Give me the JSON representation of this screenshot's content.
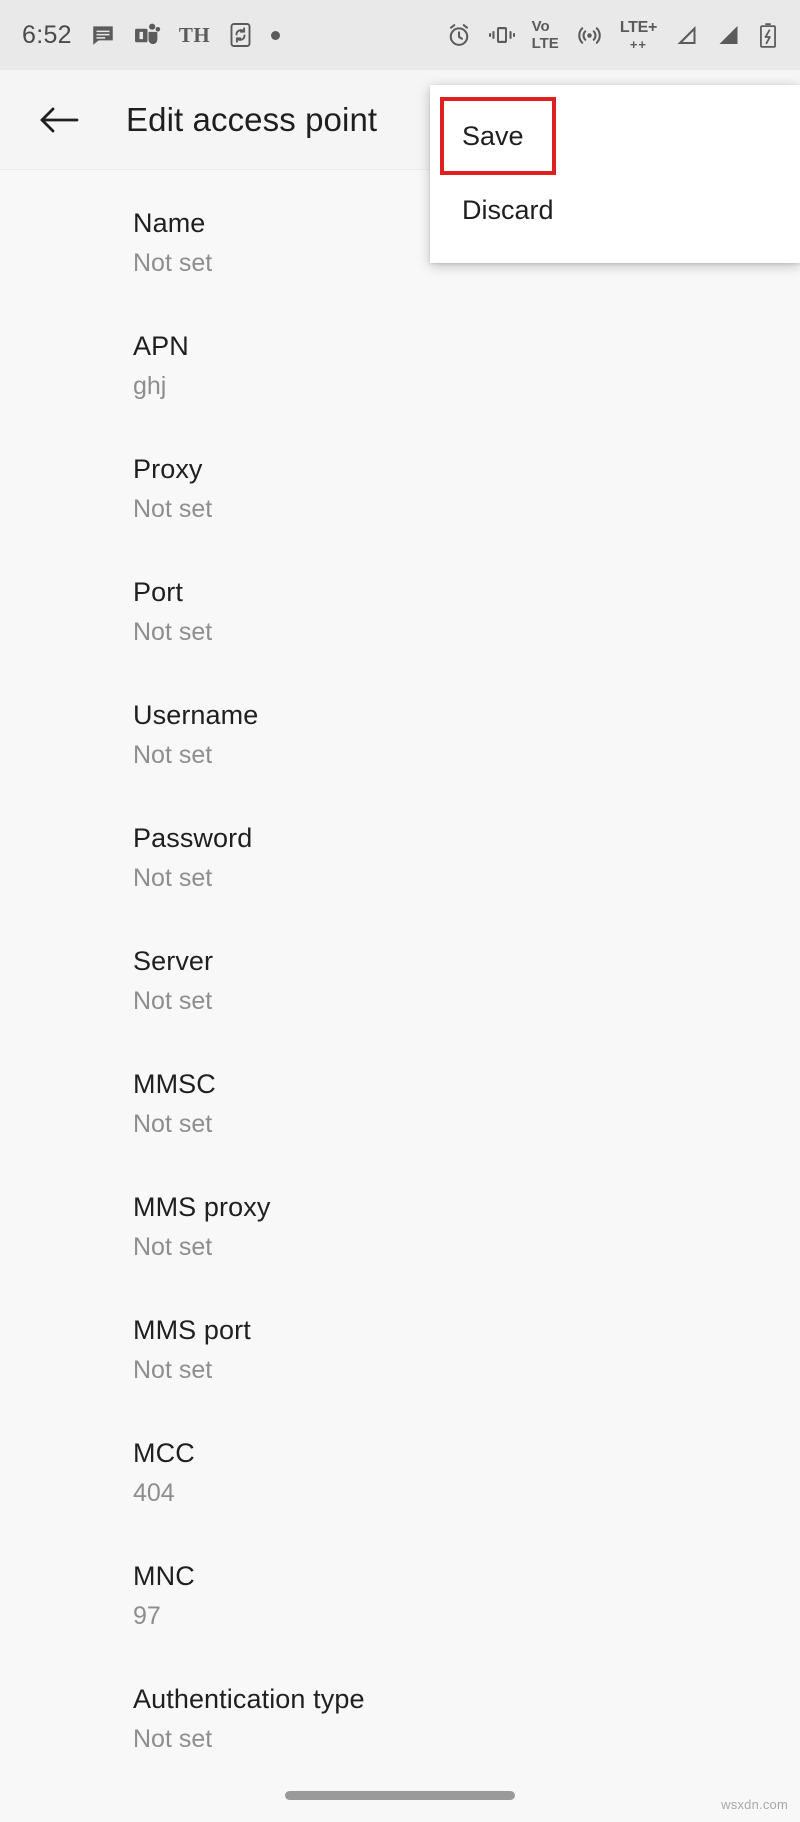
{
  "status_bar": {
    "time": "6:52",
    "left_icons": [
      {
        "name": "messages-icon",
        "glyph": "messages"
      },
      {
        "name": "teams-icon",
        "glyph": "teams"
      },
      {
        "name": "th-keyboard-indicator",
        "glyph": "TH"
      },
      {
        "name": "phone-sync-icon",
        "glyph": "phone-sync"
      },
      {
        "name": "notification-dot-icon",
        "glyph": "dot"
      }
    ],
    "right_icons": [
      {
        "name": "alarm-icon",
        "glyph": "alarm"
      },
      {
        "name": "vibrate-icon",
        "glyph": "vibrate"
      },
      {
        "name": "volte-icon",
        "label_top": "Vo",
        "label_bottom": "LTE"
      },
      {
        "name": "hotspot-icon",
        "glyph": "hotspot"
      },
      {
        "name": "lte-plus-icon",
        "label_top": "LTE+",
        "label_bottom": "++"
      },
      {
        "name": "signal-sim1-icon",
        "glyph": "signal"
      },
      {
        "name": "signal-sim2-icon",
        "glyph": "signal"
      },
      {
        "name": "battery-charging-icon",
        "glyph": "battery-charging"
      }
    ]
  },
  "app_bar": {
    "back_label": "Back",
    "title": "Edit access point"
  },
  "overflow_menu": {
    "items": [
      {
        "label": "Save",
        "highlighted": true
      },
      {
        "label": "Discard",
        "highlighted": false
      }
    ]
  },
  "settings_list": {
    "rows": [
      {
        "title": "Name",
        "value": "Not set"
      },
      {
        "title": "APN",
        "value": "ghj"
      },
      {
        "title": "Proxy",
        "value": "Not set"
      },
      {
        "title": "Port",
        "value": "Not set"
      },
      {
        "title": "Username",
        "value": "Not set"
      },
      {
        "title": "Password",
        "value": "Not set"
      },
      {
        "title": "Server",
        "value": "Not set"
      },
      {
        "title": "MMSC",
        "value": "Not set"
      },
      {
        "title": "MMS proxy",
        "value": "Not set"
      },
      {
        "title": "MMS port",
        "value": "Not set"
      },
      {
        "title": "MCC",
        "value": "404"
      },
      {
        "title": "MNC",
        "value": "97"
      },
      {
        "title": "Authentication type",
        "value": "Not set"
      }
    ]
  },
  "nav_bar": {
    "home_pill_label": "Home"
  },
  "watermark": {
    "text": "wsxdn.com"
  },
  "colors": {
    "highlight": "#e02020",
    "statusbar_bg": "#e9e9e9",
    "appbar_bg": "#f5f5f5",
    "page_bg": "#f8f8f8",
    "title_text": "#1f1f1f",
    "value_text": "#8e8e8e"
  }
}
